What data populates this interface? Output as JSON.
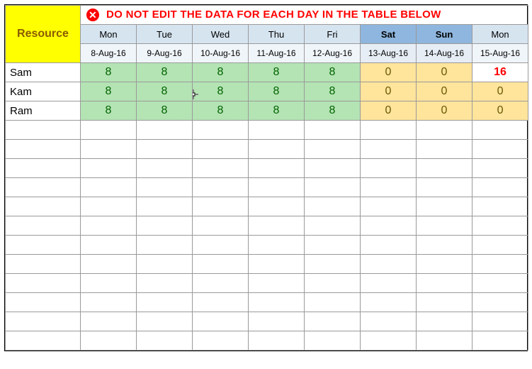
{
  "header": {
    "resource_label": "Resource",
    "warning_text": "DO NOT EDIT THE DATA FOR EACH DAY IN THE TABLE BELOW",
    "warning_icon_glyph": "✕"
  },
  "days": [
    {
      "name": "Mon",
      "date": "8-Aug-16",
      "weekend": false
    },
    {
      "name": "Tue",
      "date": "9-Aug-16",
      "weekend": false
    },
    {
      "name": "Wed",
      "date": "10-Aug-16",
      "weekend": false
    },
    {
      "name": "Thu",
      "date": "11-Aug-16",
      "weekend": false
    },
    {
      "name": "Fri",
      "date": "12-Aug-16",
      "weekend": false
    },
    {
      "name": "Sat",
      "date": "13-Aug-16",
      "weekend": true
    },
    {
      "name": "Sun",
      "date": "14-Aug-16",
      "weekend": true
    },
    {
      "name": "Mon",
      "date": "15-Aug-16",
      "weekend": false
    }
  ],
  "rows": [
    {
      "name": "Sam",
      "values": [
        "8",
        "8",
        "8",
        "8",
        "8",
        "0",
        "0",
        "16"
      ],
      "styles": [
        "wd",
        "wd",
        "wd",
        "wd",
        "wd",
        "we",
        "we",
        "alert"
      ]
    },
    {
      "name": "Kam",
      "values": [
        "8",
        "8",
        "8",
        "8",
        "8",
        "0",
        "0",
        "0"
      ],
      "styles": [
        "wd",
        "wd",
        "wd",
        "wd",
        "wd",
        "we",
        "we",
        "we"
      ]
    },
    {
      "name": "Ram",
      "values": [
        "8",
        "8",
        "8",
        "8",
        "8",
        "0",
        "0",
        "0"
      ],
      "styles": [
        "wd",
        "wd",
        "wd",
        "wd",
        "wd",
        "we",
        "we",
        "we"
      ]
    }
  ],
  "empty_row_count": 12,
  "cursor": {
    "row": 1,
    "col": 2
  }
}
